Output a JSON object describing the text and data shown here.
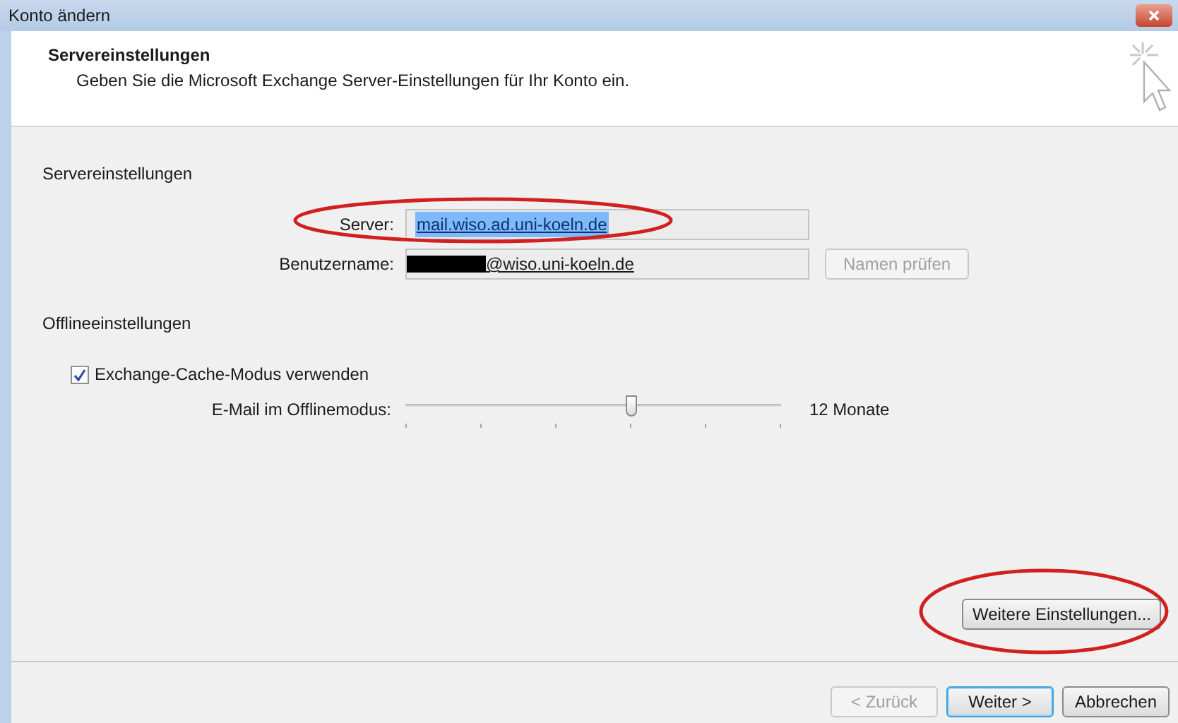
{
  "window": {
    "title": "Konto ändern"
  },
  "header": {
    "title": "Servereinstellungen",
    "subtitle": "Geben Sie die Microsoft Exchange Server-Einstellungen für Ihr Konto ein."
  },
  "server_settings": {
    "heading": "Servereinstellungen",
    "server": {
      "label": "Server:",
      "value": "mail.wiso.ad.uni-koeln.de"
    },
    "username": {
      "label": "Benutzername:",
      "value": "@wiso.uni-koeln.de"
    },
    "check_names_button": {
      "label": "Namen prüfen",
      "disabled": true
    }
  },
  "offline_settings": {
    "heading": "Offlineeinstellungen",
    "cache_mode": {
      "label": "Exchange-Cache-Modus verwenden",
      "checked": true
    },
    "offline_mail": {
      "label": "E-Mail im Offlinemodus:",
      "level": 0.6,
      "reading": "12 Monate"
    }
  },
  "more_settings_button": {
    "label": "Weitere Einstellungen..."
  },
  "buttons": [
    {
      "label": "< Zurück",
      "disabled": true,
      "default": false
    },
    {
      "label": "Weiter >",
      "disabled": false,
      "default": true
    },
    {
      "label": "Abbrechen",
      "disabled": false,
      "default": false
    }
  ]
}
